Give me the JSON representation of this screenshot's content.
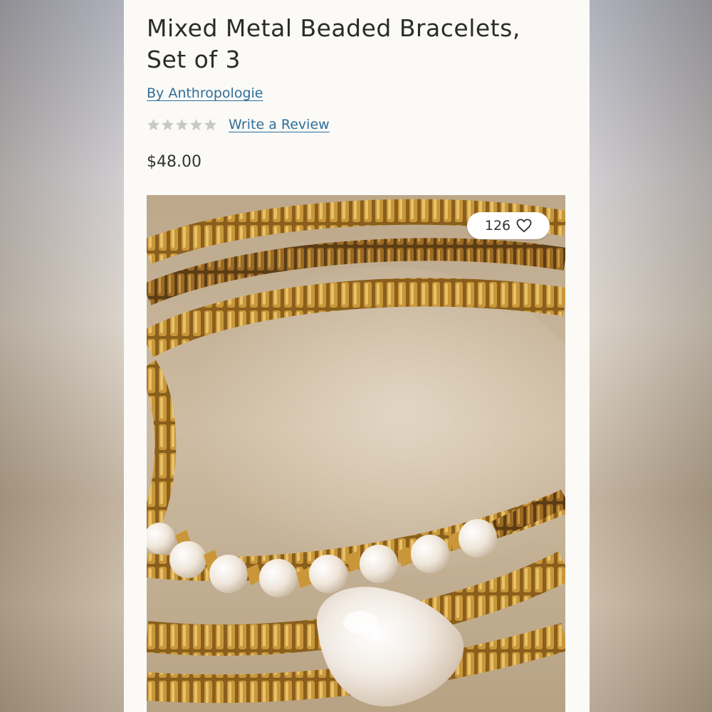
{
  "product": {
    "title": "Mixed Metal Beaded Bracelets, Set of 3",
    "brand_link": "By Anthropologie",
    "rating": {
      "stars_filled": 0,
      "stars_total": 5,
      "review_link": "Write a Review"
    },
    "price": "$48.00"
  },
  "image": {
    "like_count": "126",
    "like_icon": "heart-outline-icon"
  },
  "colors": {
    "link": "#2f6f99",
    "text": "#2b2b2b",
    "star_empty": "#c8c8c8",
    "gold": "#b8862e",
    "pearl": "#f4efe6"
  }
}
